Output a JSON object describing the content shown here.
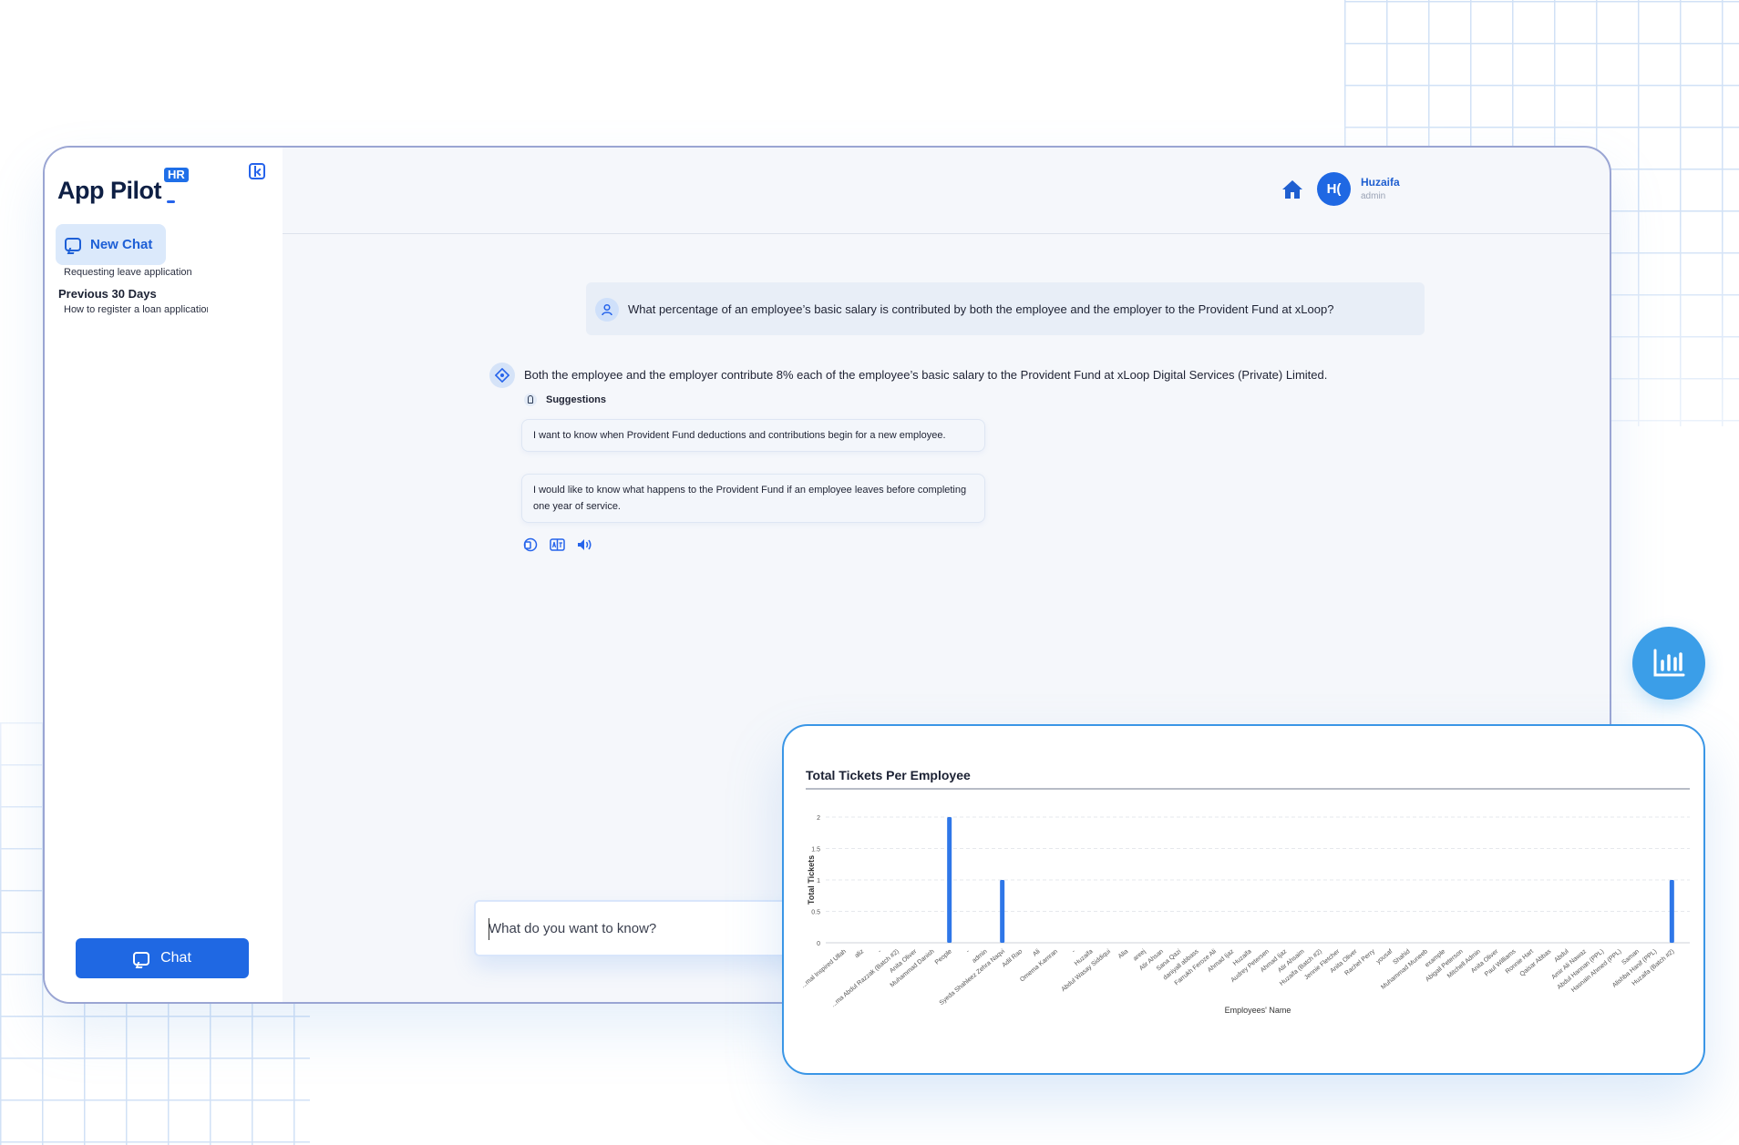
{
  "brand": {
    "name": "App Pilot",
    "badge": "HR"
  },
  "sidebar": {
    "new_chat_label": "New Chat",
    "section_title": "Previous 30 Days",
    "history": [
      {
        "label": "Requesting leave application"
      },
      {
        "label": "How to register a loan application"
      }
    ],
    "chat_button_label": "Chat"
  },
  "header": {
    "avatar_initials": "H(",
    "user_name": "Huzaifa",
    "user_role": "admin"
  },
  "conversation": {
    "question": "What percentage of an employee’s basic salary is contributed by both the employee and the employer to the Provident Fund at xLoop?",
    "answer": "Both the employee and the employer contribute 8% each of the employee’s basic salary to the Provident Fund at xLoop Digital Services (Private) Limited.",
    "suggestions_label": "Suggestions",
    "suggestions": [
      {
        "text": "I want to know when Provident Fund deductions and contributions begin for a new employee."
      },
      {
        "text": "I would like to know what happens to the Provident Fund if an employee leaves before completing one year of service."
      }
    ]
  },
  "composer": {
    "placeholder": "What do you want to know?"
  },
  "colors": {
    "accent": "#1f68e3",
    "chart_bar": "#2f77e8",
    "card_border": "#3a96e6"
  },
  "chart_data": {
    "type": "bar",
    "title": "Total Tickets Per Employee",
    "xlabel": "Employees' Name",
    "ylabel": "Total Tickets",
    "ylim": [
      0,
      2
    ],
    "yticks": [
      "0",
      "0.5",
      "1",
      "1.5",
      "2"
    ],
    "grid": true,
    "categories": [
      "...mal Inspired Ullah",
      "aliz",
      "-",
      "...ma Abdul Razzak (Batch #2)",
      "Anita Oliver",
      "Muhammad Danish",
      "People",
      "-",
      "admin",
      "Syeda Shahleez Zehra Naqvi",
      "Adil Rao",
      "Ali",
      "Omema Kamran",
      "-",
      "Huzaifa",
      "Abdul Wasay Siddiqui",
      "Alia",
      "areej",
      "Atir Ahsan",
      "Sana Qazi",
      "daniyall abbass",
      "Farrukh Feroze Ali",
      "Ahmad Ijaz",
      "Huzaifa",
      "Audrey Petersen",
      "Ahmad Ijaz",
      "Atir Ahsaim",
      "Huzaifa (Batch #2)",
      "Jennie Fletcher",
      "Anita Oliver",
      "Rachel Perry",
      "yousaf",
      "Shahid",
      "Muhammad Muneeb",
      "example",
      "Abigail Peterson",
      "Mitchell Admin",
      "Anita Oliver",
      "Paul Williams",
      "Ronnie Hart",
      "Qaisar Abbas",
      "Abdul",
      "Amir Ali Nawaz",
      "Abdul Hannan (PPL)",
      "Hasnain Ahmed (PPL)",
      "Saman",
      "Alishba Hanif (PPL)",
      "Huzaifa (Batch #2)"
    ],
    "values": [
      0,
      0,
      0,
      0,
      0,
      0,
      2,
      0,
      0,
      1,
      0,
      0,
      0,
      0,
      0,
      0,
      0,
      0,
      0,
      0,
      0,
      0,
      0,
      0,
      0,
      0,
      0,
      0,
      0,
      0,
      0,
      0,
      0,
      0,
      0,
      0,
      0,
      0,
      0,
      0,
      0,
      0,
      0,
      0,
      0,
      0,
      0,
      1
    ]
  }
}
